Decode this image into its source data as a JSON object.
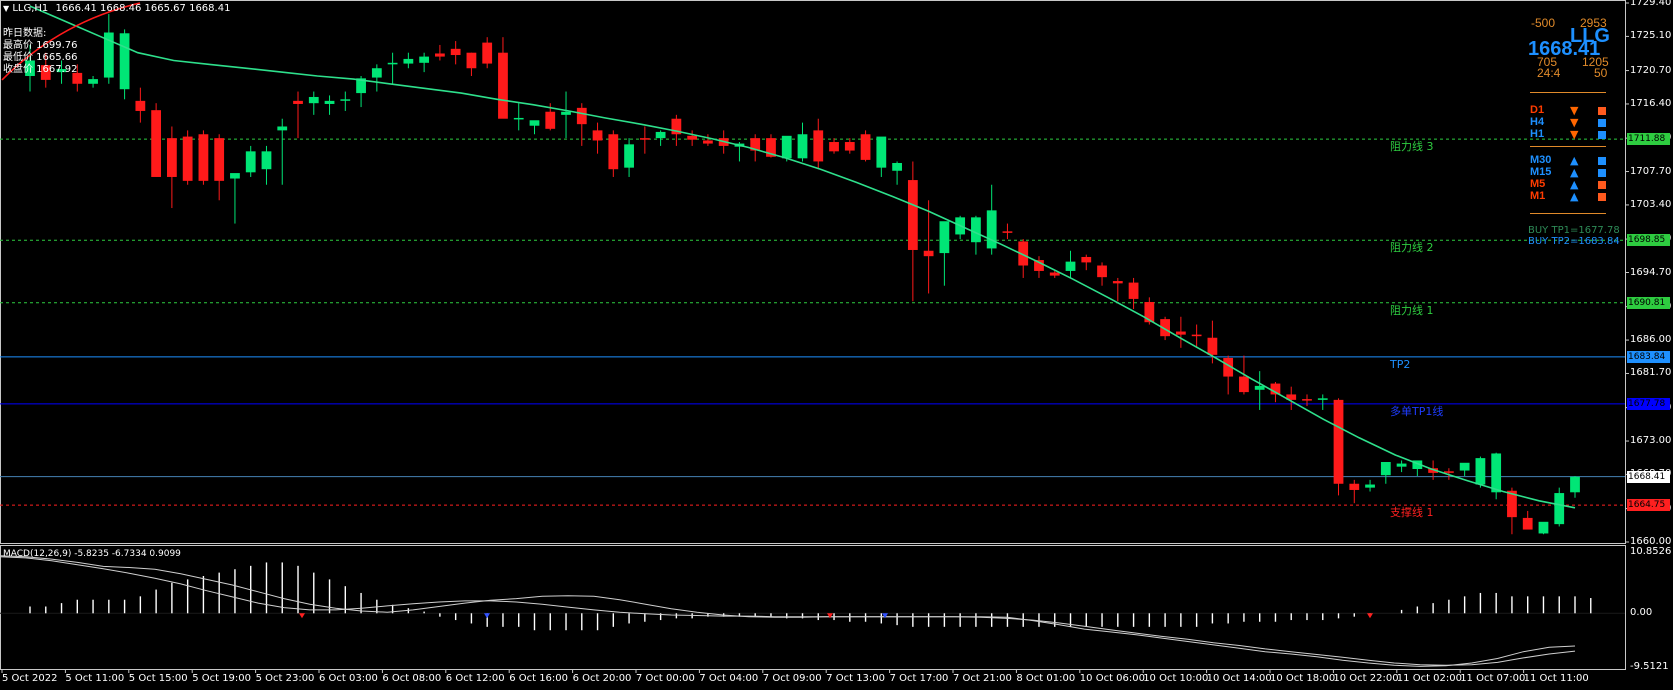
{
  "header": {
    "symbol_tf": "LLG,H1",
    "ohlc": "1666.41 1668.46 1665.67 1668.41"
  },
  "info_panel": {
    "title": "昨日数据:",
    "high": "最高价 1699.76",
    "low": "最低价 1665.66",
    "close": "收盘价 1667.92"
  },
  "hud": {
    "minus": "-500",
    "top_right": "2953",
    "symbol": "LLG",
    "price": "1668.41",
    "v1": "705",
    "v2": "1205",
    "v3": "24:4",
    "v4": "50"
  },
  "timeframes": [
    {
      "label": "D1",
      "dir": "down",
      "arrow_color": "#ff6600",
      "label_color": "#ff3c00",
      "sq_color": "#ff5a1e"
    },
    {
      "label": "H4",
      "dir": "down",
      "arrow_color": "#ff6600",
      "label_color": "#1e90ff",
      "sq_color": "#1e90ff"
    },
    {
      "label": "H1",
      "dir": "down",
      "arrow_color": "#ff6600",
      "label_color": "#1e90ff",
      "sq_color": "#1e90ff"
    },
    {
      "label": "M30",
      "dir": "up",
      "arrow_color": "#1e90ff",
      "label_color": "#1e90ff",
      "sq_color": "#1e90ff"
    },
    {
      "label": "M15",
      "dir": "up",
      "arrow_color": "#1e90ff",
      "label_color": "#1e90ff",
      "sq_color": "#1e90ff"
    },
    {
      "label": "M5",
      "dir": "up",
      "arrow_color": "#1e90ff",
      "label_color": "#ff3c00",
      "sq_color": "#ff5a1e"
    },
    {
      "label": "M1",
      "dir": "up",
      "arrow_color": "#1e90ff",
      "label_color": "#ff3c00",
      "sq_color": "#ff5a1e"
    }
  ],
  "tp_text": {
    "tp1": "BUY TP1=1677.78",
    "tp2": "BUY TP2=1683.84"
  },
  "levels": [
    {
      "name": "阻力线 3",
      "price": 1711.88,
      "tag": "1711.88",
      "color": "#2ecc40",
      "style": "dash",
      "tag_bg": "#2ecc40",
      "label_color": "#2ecc40"
    },
    {
      "name": "阻力线 2",
      "price": 1698.85,
      "tag": "1698.85",
      "color": "#2ecc40",
      "style": "dash",
      "tag_bg": "#2ecc40",
      "label_color": "#2ecc40"
    },
    {
      "name": "阻力线 1",
      "price": 1690.81,
      "tag": "1690.81",
      "color": "#2ecc40",
      "style": "dash",
      "tag_bg": "#2ecc40",
      "label_color": "#2ecc40"
    },
    {
      "name": "TP2",
      "price": 1683.84,
      "tag": "1683.84",
      "color": "#1e90ff",
      "style": "solid",
      "tag_bg": "#1e90ff",
      "label_color": "#1e90ff"
    },
    {
      "name": "多单TP1线",
      "price": 1677.78,
      "tag": "1677.78",
      "color": "#0000ff",
      "style": "solid",
      "tag_bg": "#0000ff",
      "label_color": "#1e3cff"
    },
    {
      "name": "",
      "price": 1668.41,
      "tag": "1668.41",
      "color": "#4682b4",
      "style": "solid",
      "tag_bg": "#ffffff",
      "label_color": "#ffffff"
    },
    {
      "name": "支撑线 1",
      "price": 1664.75,
      "tag": "1664.75",
      "color": "#ff2020",
      "style": "dash",
      "tag_bg": "#ff2020",
      "label_color": "#ff2020"
    }
  ],
  "price_axis": [
    "1729.40",
    "1725.10",
    "1720.70",
    "1716.40",
    "1712.00",
    "1707.70",
    "1703.40",
    "1699.00",
    "1694.70",
    "1690.30",
    "1686.00",
    "1681.70",
    "1677.30",
    "1673.00",
    "1668.70",
    "1664.30",
    "1660.00"
  ],
  "macd": {
    "label": "MACD(12,26,9) -5.8235 -6.7334 0.9099",
    "axis": [
      "10.8526",
      "0.00",
      "-9.5121"
    ]
  },
  "time_axis": [
    "5 Oct 2022",
    "5 Oct 11:00",
    "5 Oct 15:00",
    "5 Oct 19:00",
    "5 Oct 23:00",
    "6 Oct 03:00",
    "6 Oct 08:00",
    "6 Oct 12:00",
    "6 Oct 16:00",
    "6 Oct 20:00",
    "7 Oct 00:00",
    "7 Oct 04:00",
    "7 Oct 09:00",
    "7 Oct 13:00",
    "7 Oct 17:00",
    "7 Oct 21:00",
    "8 Oct 01:00",
    "10 Oct 06:00",
    "10 Oct 10:00",
    "10 Oct 14:00",
    "10 Oct 18:00",
    "10 Oct 22:00",
    "11 Oct 02:00",
    "11 Oct 07:00",
    "11 Oct 11:00"
  ],
  "colors": {
    "bull": "#00e676",
    "bear": "#ff1a1a",
    "ma": "#2ee08c",
    "ma_red": "#ff1a1a"
  },
  "chart_data": {
    "type": "candlestick",
    "candles": [
      [
        1720.0,
        1724.0,
        1718.0,
        1722.0
      ],
      [
        1721.4,
        1723.0,
        1718.5,
        1719.5
      ],
      [
        1720.5,
        1722.0,
        1719.0,
        1720.9
      ],
      [
        1720.4,
        1721.5,
        1718.0,
        1719.0
      ],
      [
        1719.0,
        1720.0,
        1718.5,
        1719.6
      ],
      [
        1719.8,
        1728.0,
        1719.0,
        1725.6
      ],
      [
        1718.3,
        1726.0,
        1717.0,
        1725.5
      ],
      [
        1716.8,
        1718.5,
        1714.0,
        1715.5
      ],
      [
        1715.6,
        1716.5,
        1707.0,
        1707.0
      ],
      [
        1712.0,
        1713.5,
        1703.0,
        1707.0
      ],
      [
        1712.2,
        1713.0,
        1706.0,
        1706.5
      ],
      [
        1712.5,
        1713.0,
        1706.0,
        1706.5
      ],
      [
        1712.0,
        1712.5,
        1704.0,
        1706.5
      ],
      [
        1706.8,
        1707.0,
        1701.0,
        1707.5
      ],
      [
        1707.6,
        1711.0,
        1707.0,
        1710.3
      ],
      [
        1708.0,
        1711.0,
        1706.0,
        1710.3
      ],
      [
        1713.0,
        1714.5,
        1706.0,
        1713.5
      ],
      [
        1716.8,
        1718.0,
        1712.0,
        1716.4
      ],
      [
        1716.5,
        1718.0,
        1715.0,
        1717.3
      ],
      [
        1716.4,
        1717.5,
        1715.0,
        1716.8
      ],
      [
        1716.9,
        1718.0,
        1715.5,
        1717.0
      ],
      [
        1717.8,
        1720.0,
        1716.0,
        1719.7
      ],
      [
        1719.8,
        1721.5,
        1718.0,
        1721.0
      ],
      [
        1721.5,
        1723.0,
        1719.0,
        1721.7
      ],
      [
        1721.6,
        1723.0,
        1721.0,
        1722.2
      ],
      [
        1721.7,
        1723.0,
        1720.5,
        1722.5
      ],
      [
        1722.9,
        1724.0,
        1722.0,
        1722.5
      ],
      [
        1723.5,
        1724.5,
        1721.5,
        1722.7
      ],
      [
        1723.0,
        1723.0,
        1720.0,
        1721.0
      ],
      [
        1724.3,
        1725.0,
        1721.0,
        1721.6
      ],
      [
        1723.0,
        1725.0,
        1716.0,
        1714.5
      ],
      [
        1714.5,
        1716.5,
        1713.0,
        1714.6
      ],
      [
        1713.6,
        1714.0,
        1712.5,
        1714.3
      ],
      [
        1715.4,
        1716.5,
        1713.0,
        1713.2
      ],
      [
        1715.0,
        1718.0,
        1712.0,
        1715.4
      ],
      [
        1715.9,
        1716.5,
        1711.0,
        1713.8
      ],
      [
        1713.0,
        1714.0,
        1710.0,
        1711.7
      ],
      [
        1712.5,
        1713.0,
        1707.0,
        1708.0
      ],
      [
        1708.2,
        1712.0,
        1707.0,
        1711.2
      ],
      [
        1712.0,
        1713.5,
        1710.0,
        1711.8
      ],
      [
        1712.0,
        1713.0,
        1711.0,
        1712.8
      ],
      [
        1714.5,
        1715.0,
        1711.0,
        1712.5
      ],
      [
        1712.3,
        1713.0,
        1711.0,
        1711.8
      ],
      [
        1711.7,
        1712.5,
        1711.0,
        1711.3
      ],
      [
        1712.0,
        1713.0,
        1710.0,
        1711.0
      ],
      [
        1710.9,
        1711.5,
        1709.0,
        1711.3
      ],
      [
        1712.0,
        1712.5,
        1709.0,
        1710.4
      ],
      [
        1712.0,
        1712.5,
        1709.5,
        1709.6
      ],
      [
        1709.4,
        1710.0,
        1709.0,
        1712.3
      ],
      [
        1709.4,
        1714.0,
        1709.0,
        1712.5
      ],
      [
        1713.0,
        1714.5,
        1708.0,
        1709.0
      ],
      [
        1711.5,
        1712.0,
        1710.0,
        1710.3
      ],
      [
        1711.5,
        1712.0,
        1710.0,
        1710.4
      ],
      [
        1712.5,
        1713.0,
        1709.0,
        1709.2
      ],
      [
        1708.2,
        1712.0,
        1707.0,
        1712.2
      ],
      [
        1707.8,
        1709.0,
        1706.0,
        1708.8
      ],
      [
        1706.6,
        1709.0,
        1691.0,
        1697.6
      ],
      [
        1697.5,
        1704.0,
        1692.0,
        1696.8
      ],
      [
        1697.2,
        1698.0,
        1693.0,
        1701.3
      ],
      [
        1699.6,
        1702.0,
        1699.0,
        1701.8
      ],
      [
        1698.6,
        1702.0,
        1697.0,
        1701.8
      ],
      [
        1697.8,
        1706.0,
        1697.0,
        1702.7
      ],
      [
        1700.0,
        1701.0,
        1699.0,
        1699.9
      ],
      [
        1698.7,
        1699.0,
        1694.0,
        1695.6
      ],
      [
        1696.3,
        1696.8,
        1694.0,
        1694.9
      ],
      [
        1694.7,
        1695.0,
        1694.0,
        1694.3
      ],
      [
        1694.9,
        1697.5,
        1694.0,
        1696.1
      ],
      [
        1696.7,
        1697.0,
        1695.0,
        1696.0
      ],
      [
        1695.6,
        1696.0,
        1693.0,
        1694.1
      ],
      [
        1693.6,
        1694.0,
        1691.0,
        1693.3
      ],
      [
        1693.4,
        1694.0,
        1690.0,
        1691.3
      ],
      [
        1690.9,
        1691.5,
        1688.0,
        1688.3
      ],
      [
        1688.7,
        1689.0,
        1686.0,
        1686.5
      ],
      [
        1687.1,
        1689.0,
        1685.0,
        1686.7
      ],
      [
        1686.7,
        1688.0,
        1685.0,
        1686.5
      ],
      [
        1686.3,
        1688.5,
        1683.0,
        1684.1
      ],
      [
        1683.7,
        1684.0,
        1679.0,
        1681.3
      ],
      [
        1681.3,
        1684.0,
        1679.0,
        1679.3
      ],
      [
        1679.6,
        1682.0,
        1677.0,
        1680.1
      ],
      [
        1680.4,
        1680.6,
        1678.0,
        1679.0
      ],
      [
        1679.0,
        1680.0,
        1677.0,
        1678.3
      ],
      [
        1678.4,
        1679.0,
        1677.5,
        1678.3
      ],
      [
        1678.3,
        1679.0,
        1677.0,
        1678.5
      ],
      [
        1678.3,
        1678.5,
        1666.0,
        1667.5
      ],
      [
        1667.5,
        1668.0,
        1665.0,
        1666.7
      ],
      [
        1667.0,
        1668.0,
        1666.5,
        1667.4
      ],
      [
        1668.6,
        1670.0,
        1667.5,
        1670.3
      ],
      [
        1669.7,
        1670.5,
        1669.0,
        1670.1
      ],
      [
        1669.4,
        1670.0,
        1668.5,
        1670.5
      ],
      [
        1669.5,
        1670.5,
        1668.0,
        1668.9
      ],
      [
        1669.1,
        1669.5,
        1668.0,
        1669.0
      ],
      [
        1669.2,
        1670.0,
        1668.5,
        1670.2
      ],
      [
        1667.4,
        1671.0,
        1667.0,
        1670.8
      ],
      [
        1666.4,
        1671.5,
        1665.5,
        1671.4
      ],
      [
        1666.6,
        1667.0,
        1661.0,
        1663.2
      ],
      [
        1663.1,
        1664.0,
        1662.0,
        1661.6
      ],
      [
        1661.1,
        1662.0,
        1661.0,
        1662.6
      ],
      [
        1662.3,
        1667.0,
        1662.0,
        1666.3
      ],
      [
        1666.4,
        1668.5,
        1665.7,
        1668.4
      ]
    ],
    "ma": [
      1729,
      1727,
      1725,
      1723,
      1722,
      1721.5,
      1721,
      1720.5,
      1720,
      1719.6,
      1719,
      1718.4,
      1717.8,
      1717,
      1716.3,
      1715.5,
      1714.6,
      1713.8,
      1712.9,
      1711.9,
      1710.8,
      1709.5,
      1708,
      1706.3,
      1704.5,
      1702.6,
      1700.5,
      1698.4,
      1696.2,
      1693.9,
      1691.5,
      1689,
      1686.3,
      1683.7,
      1681,
      1678.4,
      1675.8,
      1673.4,
      1671.2,
      1669.4,
      1667.9,
      1666.5,
      1665.3,
      1664.4
    ],
    "macd_hist": [
      0.4,
      0.4,
      0.6,
      0.8,
      0.8,
      0.8,
      0.8,
      1.0,
      1.4,
      1.8,
      2.0,
      2.2,
      2.4,
      2.6,
      2.8,
      3.0,
      3.0,
      2.8,
      2.4,
      2.0,
      1.6,
      1.2,
      0.8,
      0.5,
      0.3,
      0.1,
      -0.2,
      -0.4,
      -0.6,
      -0.8,
      -0.8,
      -0.8,
      -1.0,
      -1.0,
      -1.0,
      -1.0,
      -1.0,
      -0.8,
      -0.6,
      -0.5,
      -0.4,
      -0.3,
      -0.3,
      -0.2,
      -0.2,
      -0.2,
      -0.2,
      -0.2,
      -0.3,
      -0.3,
      -0.4,
      -0.4,
      -0.5,
      -0.5,
      -0.6,
      -0.7,
      -0.8,
      -0.8,
      -0.8,
      -0.8,
      -0.8,
      -0.8,
      -0.8,
      -0.8,
      -0.8,
      -0.8,
      -0.8,
      -0.8,
      -0.8,
      -0.8,
      -0.8,
      -0.8,
      -0.8,
      -0.8,
      -0.8,
      -0.6,
      -0.6,
      -0.5,
      -0.5,
      -0.5,
      -0.4,
      -0.4,
      -0.4,
      -0.3,
      -0.2,
      -0.1,
      0.0,
      0.2,
      0.4,
      0.6,
      0.8,
      1.0,
      1.2,
      1.2,
      1.0,
      1.0,
      1.0,
      1.0,
      1.0,
      0.9
    ],
    "macd_line": [
      10.2,
      10.0,
      9.6,
      9.0,
      8.3,
      8.1,
      7.8,
      7.0,
      6.0,
      5.0,
      3.8,
      2.6,
      1.6,
      0.9,
      0.4,
      0.2,
      0.6,
      1.2,
      1.8,
      2.3,
      2.6,
      3.0,
      3.1,
      3.0,
      2.4,
      1.6,
      0.8,
      0.2,
      -0.3,
      -0.6,
      -0.7,
      -0.7,
      -0.6,
      -0.6,
      -0.6,
      -0.6,
      -0.6,
      -0.6,
      -0.6,
      -0.7,
      -1.3,
      -2.0,
      -2.8,
      -3.3,
      -3.8,
      -4.4,
      -5.0,
      -5.6,
      -6.2,
      -6.8,
      -7.2,
      -7.7,
      -8.3,
      -8.8,
      -9.2,
      -9.4,
      -9.3,
      -8.8,
      -8.0,
      -6.8,
      -6.0,
      -5.8
    ],
    "signal_line": [
      10.0,
      9.8,
      9.3,
      8.6,
      7.9,
      7.1,
      6.2,
      5.2,
      4.0,
      2.9,
      1.8,
      1.0,
      0.6,
      0.6,
      0.9,
      1.3,
      1.7,
      2.0,
      2.2,
      2.2,
      2.0,
      1.6,
      1.1,
      0.6,
      0.2,
      -0.1,
      -0.3,
      -0.4,
      -0.5,
      -0.5,
      -0.6,
      -0.6,
      -0.6,
      -0.6,
      -0.6,
      -0.6,
      -0.6,
      -0.6,
      -0.7,
      -0.9,
      -1.2,
      -1.7,
      -2.3,
      -2.9,
      -3.5,
      -4.1,
      -4.6,
      -5.2,
      -5.7,
      -6.3,
      -6.8,
      -7.3,
      -7.8,
      -8.3,
      -8.8,
      -9.1,
      -9.2,
      -9.1,
      -8.7,
      -7.9,
      -7.2,
      -6.7
    ]
  }
}
